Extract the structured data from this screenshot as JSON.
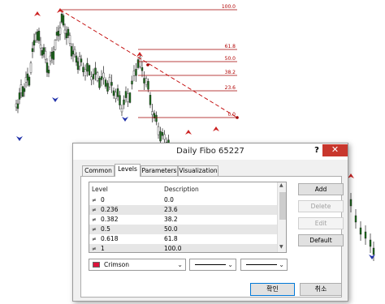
{
  "chart": {
    "fib_levels": [
      "100.0",
      "61.8",
      "50.0",
      "38.2",
      "23.6",
      "0.0"
    ]
  },
  "dialog": {
    "title": "Daily Fibo 65227",
    "help": "?",
    "close": "✕",
    "tabs": [
      {
        "label": "Common",
        "active": false
      },
      {
        "label": "Levels",
        "active": true
      },
      {
        "label": "Parameters",
        "active": false
      },
      {
        "label": "Visualization",
        "active": false
      }
    ],
    "levels_table": {
      "headers": {
        "level": "Level",
        "description": "Description"
      },
      "rows": [
        {
          "level": "0",
          "description": "0.0"
        },
        {
          "level": "0.236",
          "description": "23.6"
        },
        {
          "level": "0.382",
          "description": "38.2"
        },
        {
          "level": "0.5",
          "description": "50.0"
        },
        {
          "level": "0.618",
          "description": "61.8"
        },
        {
          "level": "1",
          "description": "100.0"
        }
      ]
    },
    "buttons": {
      "add": "Add",
      "delete": "Delete",
      "edit": "Edit",
      "default": "Default",
      "ok": "확인",
      "cancel": "취소"
    },
    "color_select": {
      "value": "Crimson",
      "color": "#dc143c"
    },
    "line_icon": "≠"
  }
}
